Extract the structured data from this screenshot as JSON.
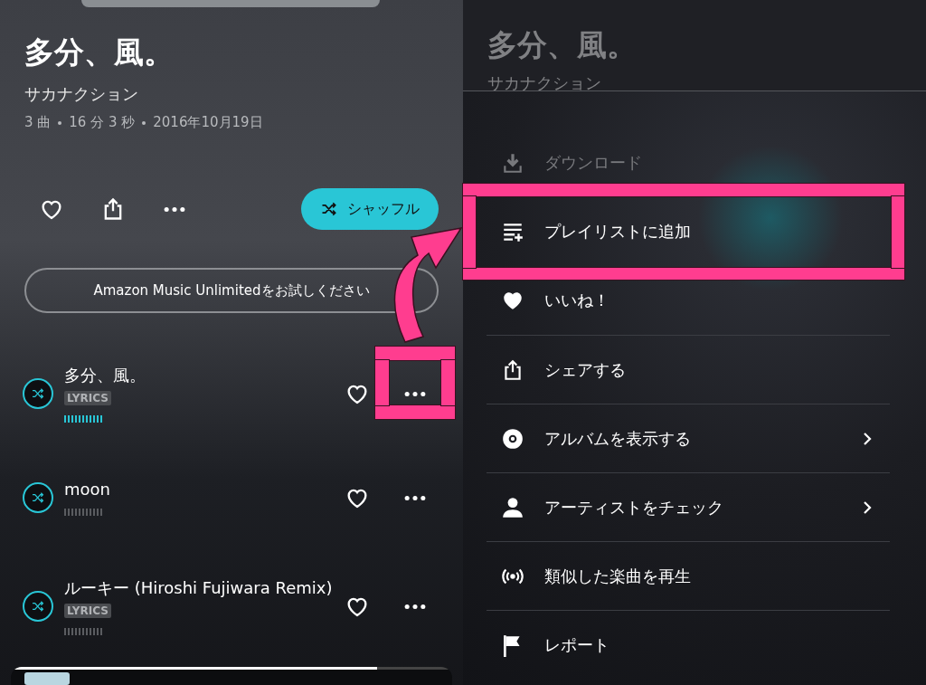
{
  "album": {
    "title": "多分、風。",
    "artist": "サカナクション",
    "meta": [
      "3 曲",
      "16 分 3 秒",
      "2016年10月19日"
    ]
  },
  "actions": {
    "shuffle_label": "シャッフル",
    "promo_label": "Amazon Music Unlimitedをお試しください"
  },
  "tracks": [
    {
      "title": "多分、風。",
      "badge": "LYRICS",
      "playing": true
    },
    {
      "title": "moon",
      "playing": false
    },
    {
      "title": "ルーキー (Hiroshi Fujiwara Remix)",
      "badge": "LYRICS",
      "playing": false
    }
  ],
  "mini_player": {
    "level": 0.83
  },
  "sheet_header": {
    "title": "多分、風。",
    "artist": "サカナクション"
  },
  "menu": [
    {
      "kind": "download",
      "label": "ダウンロード",
      "disabled": true,
      "chevron": false
    },
    {
      "kind": "playlist",
      "label": "プレイリストに追加",
      "disabled": false,
      "chevron": false
    },
    {
      "kind": "like",
      "label": "いいね！",
      "disabled": false,
      "chevron": false
    },
    {
      "kind": "share",
      "label": "シェアする",
      "disabled": false,
      "chevron": false
    },
    {
      "kind": "album",
      "label": "アルバムを表示する",
      "disabled": false,
      "chevron": true
    },
    {
      "kind": "artist",
      "label": "アーティストをチェック",
      "disabled": false,
      "chevron": true
    },
    {
      "kind": "radio",
      "label": "類似した楽曲を再生",
      "disabled": false,
      "chevron": false
    },
    {
      "kind": "report",
      "label": "レポート",
      "disabled": false,
      "chevron": false
    }
  ]
}
